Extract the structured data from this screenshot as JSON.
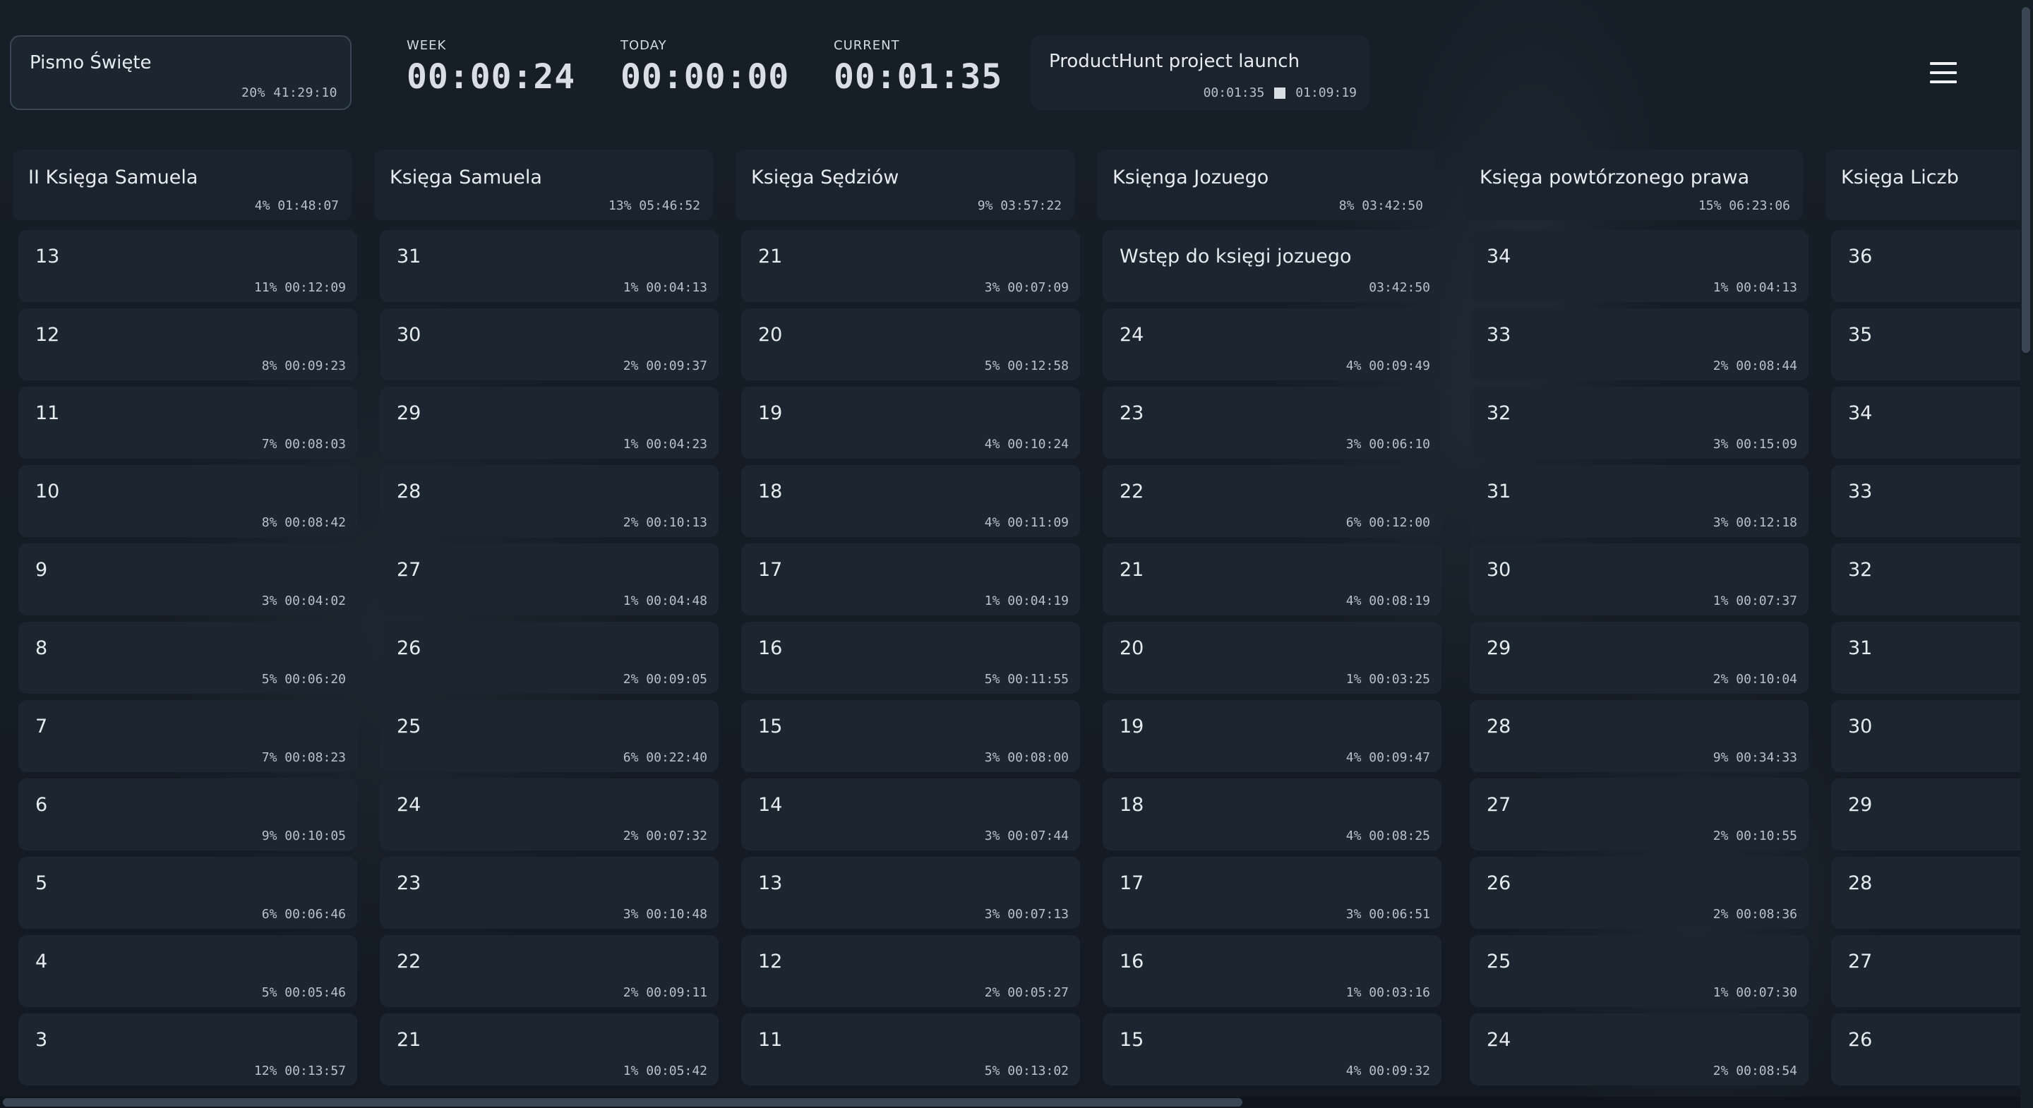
{
  "header": {
    "main_project": {
      "title": "Pismo Święte",
      "meta": "20% 41:29:10"
    },
    "timers": [
      {
        "id": "week",
        "label": "WEEK",
        "value": "00:00:24"
      },
      {
        "id": "today",
        "label": "TODAY",
        "value": "00:00:00"
      },
      {
        "id": "current",
        "label": "CURRENT",
        "value": "00:01:35"
      }
    ],
    "active_project": {
      "title": "ProductHunt project launch",
      "elapsed": "00:01:35",
      "total": "01:09:19"
    },
    "menu_icon": "hamburger-menu-icon"
  },
  "columns": [
    {
      "title": "II Księga Samuela",
      "meta": "4% 01:48:07",
      "tasks": [
        {
          "title": "13",
          "meta": "11% 00:12:09"
        },
        {
          "title": "12",
          "meta": "8% 00:09:23"
        },
        {
          "title": "11",
          "meta": "7% 00:08:03"
        },
        {
          "title": "10",
          "meta": "8% 00:08:42"
        },
        {
          "title": "9",
          "meta": "3% 00:04:02"
        },
        {
          "title": "8",
          "meta": "5% 00:06:20"
        },
        {
          "title": "7",
          "meta": "7% 00:08:23"
        },
        {
          "title": "6",
          "meta": "9% 00:10:05"
        },
        {
          "title": "5",
          "meta": "6% 00:06:46"
        },
        {
          "title": "4",
          "meta": "5% 00:05:46"
        },
        {
          "title": "3",
          "meta": "12% 00:13:57"
        }
      ]
    },
    {
      "title": "Księga Samuela",
      "meta": "13% 05:46:52",
      "tasks": [
        {
          "title": "31",
          "meta": "1% 00:04:13"
        },
        {
          "title": "30",
          "meta": "2% 00:09:37"
        },
        {
          "title": "29",
          "meta": "1% 00:04:23"
        },
        {
          "title": "28",
          "meta": "2% 00:10:13"
        },
        {
          "title": "27",
          "meta": "1% 00:04:48"
        },
        {
          "title": "26",
          "meta": "2% 00:09:05"
        },
        {
          "title": "25",
          "meta": "6% 00:22:40"
        },
        {
          "title": "24",
          "meta": "2% 00:07:32"
        },
        {
          "title": "23",
          "meta": "3% 00:10:48"
        },
        {
          "title": "22",
          "meta": "2% 00:09:11"
        },
        {
          "title": "21",
          "meta": "1% 00:05:42"
        }
      ]
    },
    {
      "title": "Księga Sędziów",
      "meta": "9% 03:57:22",
      "tasks": [
        {
          "title": "21",
          "meta": "3% 00:07:09"
        },
        {
          "title": "20",
          "meta": "5% 00:12:58"
        },
        {
          "title": "19",
          "meta": "4% 00:10:24"
        },
        {
          "title": "18",
          "meta": "4% 00:11:09"
        },
        {
          "title": "17",
          "meta": "1% 00:04:19"
        },
        {
          "title": "16",
          "meta": "5% 00:11:55"
        },
        {
          "title": "15",
          "meta": "3% 00:08:00"
        },
        {
          "title": "14",
          "meta": "3% 00:07:44"
        },
        {
          "title": "13",
          "meta": "3% 00:07:13"
        },
        {
          "title": "12",
          "meta": "2% 00:05:27"
        },
        {
          "title": "11",
          "meta": "5% 00:13:02"
        }
      ]
    },
    {
      "title": "Księnga Jozuego",
      "meta": "8% 03:42:50",
      "tasks": [
        {
          "title": "Wstęp do księgi jozuego",
          "meta": "03:42:50"
        },
        {
          "title": "24",
          "meta": "4% 00:09:49"
        },
        {
          "title": "23",
          "meta": "3% 00:06:10"
        },
        {
          "title": "22",
          "meta": "6% 00:12:00"
        },
        {
          "title": "21",
          "meta": "4% 00:08:19"
        },
        {
          "title": "20",
          "meta": "1% 00:03:25"
        },
        {
          "title": "19",
          "meta": "4% 00:09:47"
        },
        {
          "title": "18",
          "meta": "4% 00:08:25"
        },
        {
          "title": "17",
          "meta": "3% 00:06:51"
        },
        {
          "title": "16",
          "meta": "1% 00:03:16"
        },
        {
          "title": "15",
          "meta": "4% 00:09:32"
        }
      ]
    },
    {
      "title": "Księga powtórzonego prawa",
      "meta": "15% 06:23:06",
      "tasks": [
        {
          "title": "34",
          "meta": "1% 00:04:13"
        },
        {
          "title": "33",
          "meta": "2% 00:08:44"
        },
        {
          "title": "32",
          "meta": "3% 00:15:09"
        },
        {
          "title": "31",
          "meta": "3% 00:12:18"
        },
        {
          "title": "30",
          "meta": "1% 00:07:37"
        },
        {
          "title": "29",
          "meta": "2% 00:10:04"
        },
        {
          "title": "28",
          "meta": "9% 00:34:33"
        },
        {
          "title": "27",
          "meta": "2% 00:10:55"
        },
        {
          "title": "26",
          "meta": "2% 00:08:36"
        },
        {
          "title": "25",
          "meta": "1% 00:07:30"
        },
        {
          "title": "24",
          "meta": "2% 00:08:54"
        }
      ]
    },
    {
      "title": "Księga Liczb",
      "meta": "",
      "tasks": [
        {
          "title": "36",
          "meta": ""
        },
        {
          "title": "35",
          "meta": ""
        },
        {
          "title": "34",
          "meta": ""
        },
        {
          "title": "33",
          "meta": ""
        },
        {
          "title": "32",
          "meta": ""
        },
        {
          "title": "31",
          "meta": ""
        },
        {
          "title": "30",
          "meta": ""
        },
        {
          "title": "29",
          "meta": ""
        },
        {
          "title": "28",
          "meta": ""
        },
        {
          "title": "27",
          "meta": ""
        },
        {
          "title": "26",
          "meta": ""
        }
      ]
    }
  ]
}
